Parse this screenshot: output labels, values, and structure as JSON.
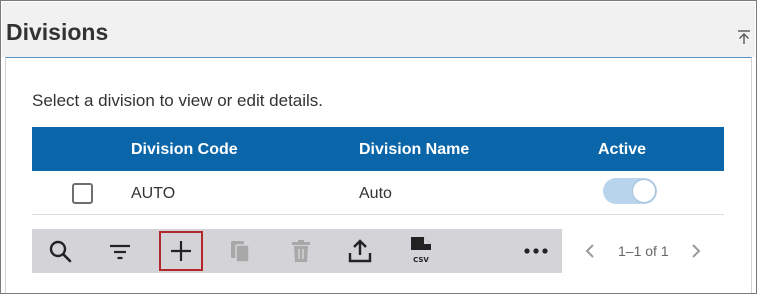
{
  "header": {
    "title": "Divisions",
    "collapse_icon": "collapse-up-icon"
  },
  "instruction": "Select a division to view or edit details.",
  "table": {
    "columns": [
      "Division Code",
      "Division Name",
      "Active"
    ],
    "rows": [
      {
        "selected": false,
        "code": "AUTO",
        "name": "Auto",
        "active": true
      }
    ],
    "header_color": "#0a66a8",
    "toggle_color": "#b9d5ee"
  },
  "toolbar": {
    "buttons": [
      {
        "name": "search",
        "icon": "search-icon",
        "enabled": true
      },
      {
        "name": "filter",
        "icon": "filter-icon",
        "enabled": true
      },
      {
        "name": "add",
        "icon": "plus-icon",
        "enabled": true,
        "highlighted": true
      },
      {
        "name": "copy",
        "icon": "copy-icon",
        "enabled": false
      },
      {
        "name": "delete",
        "icon": "trash-icon",
        "enabled": false
      },
      {
        "name": "export",
        "icon": "upload-icon",
        "enabled": true
      },
      {
        "name": "csv",
        "icon": "csv-file-icon",
        "enabled": true,
        "label": "CSV"
      },
      {
        "name": "more",
        "icon": "more-horizontal-icon",
        "enabled": true
      }
    ],
    "highlight_color": "#b3262b"
  },
  "pagination": {
    "info": "1–1 of 1",
    "prev_icon": "chevron-left-icon",
    "next_icon": "chevron-right-icon"
  }
}
